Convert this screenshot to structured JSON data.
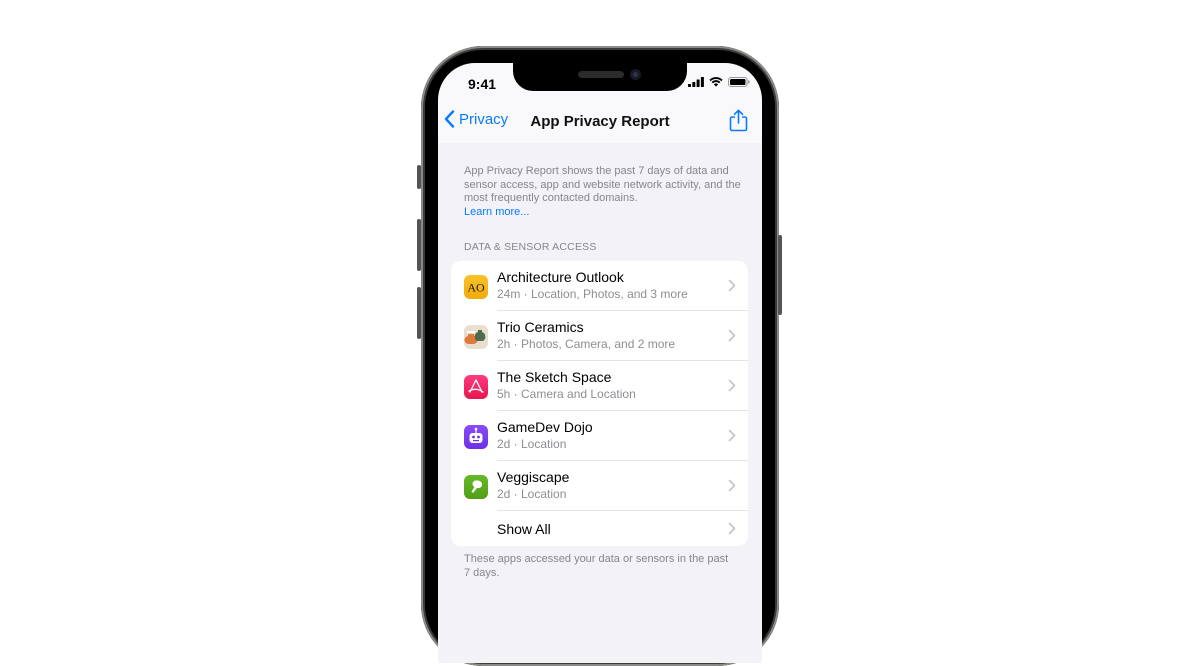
{
  "status_bar": {
    "time": "9:41"
  },
  "nav": {
    "back_label": "Privacy",
    "title": "App Privacy Report",
    "share_icon": "share-icon"
  },
  "intro": {
    "text": "App Privacy Report shows the past 7 days of data and sensor access, app and website network activity, and the most frequently contacted domains.",
    "link": "Learn more..."
  },
  "section": {
    "header": "DATA & SENSOR ACCESS",
    "items": [
      {
        "name": "Architecture Outlook",
        "detail": "24m · Location, Photos, and 3 more",
        "icon": "ao-app-icon",
        "color": "#f5b70f"
      },
      {
        "name": "Trio Ceramics",
        "detail": "2h · Photos, Camera, and 2 more",
        "icon": "vases-app-icon",
        "color": "#e8dccb"
      },
      {
        "name": "The Sketch Space",
        "detail": "5h · Camera and Location",
        "icon": "sketch-app-icon",
        "color": "#f0245f"
      },
      {
        "name": "GameDev Dojo",
        "detail": "2d · Location",
        "icon": "robot-app-icon",
        "color": "#7b3fef"
      },
      {
        "name": "Veggiscape",
        "detail": "2d · Location",
        "icon": "broccoli-app-icon",
        "color": "#5aae1c"
      }
    ],
    "show_all": "Show All",
    "footer": "These apps accessed your data or sensors in the past 7 days."
  },
  "colors": {
    "accent": "#0a7aff",
    "background": "#f2f2f7"
  }
}
